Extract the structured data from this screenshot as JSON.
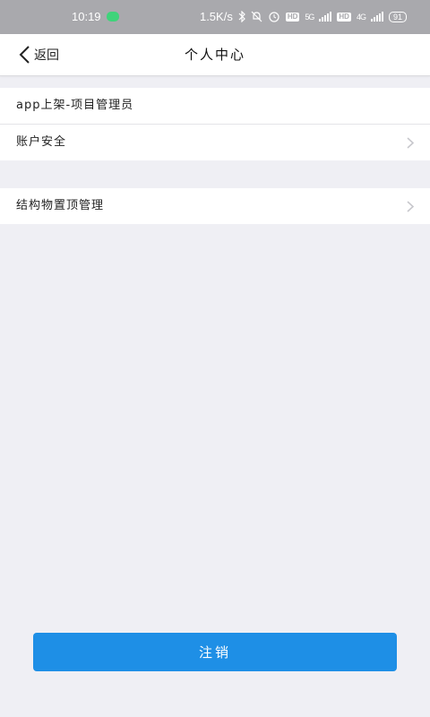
{
  "status_bar": {
    "time": "10:19",
    "network_speed": "1.5K/s",
    "sim1_type": "5G",
    "sim2_type": "4G",
    "hd_label": "HD",
    "battery": "91"
  },
  "header": {
    "back_label": "返回",
    "title": "个人中心"
  },
  "groups": [
    {
      "rows": [
        {
          "label": "app上架-项目管理员"
        },
        {
          "label": "账户安全"
        }
      ]
    },
    {
      "rows": [
        {
          "label": "结构物置顶管理"
        }
      ]
    }
  ],
  "logout_label": "注销",
  "colors": {
    "background": "#efeff4",
    "status_bar": "#a9a9ad",
    "primary_button": "#1e8fe6",
    "chevron": "#c7c7cc"
  },
  "icons": {
    "back": "chevron-left-icon",
    "row_arrow": "chevron-right-icon",
    "wechat": "wechat-icon",
    "bluetooth": "bluetooth-icon",
    "mute": "mute-icon",
    "alarm": "alarm-icon"
  }
}
